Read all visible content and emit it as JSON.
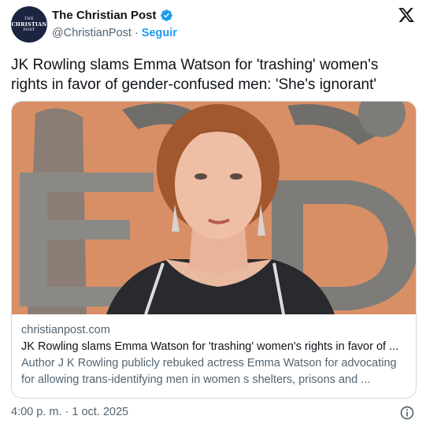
{
  "header": {
    "avatar_lines": [
      "THE",
      "CHRISTIAN",
      "POST"
    ],
    "display_name": "The Christian Post",
    "handle": "@ChristianPost",
    "separator": "·",
    "follow_label": "Seguir",
    "verified_icon": "verified-badge-icon",
    "platform_icon": "x-logo-icon"
  },
  "tweet": {
    "text": "JK Rowling slams Emma Watson for 'trashing' women's rights in favor of gender-confused men: 'She's ignorant'"
  },
  "link_card": {
    "image_icon": "news-photo",
    "domain": "christianpost.com",
    "title": "JK Rowling slams Emma Watson for 'trashing' women's rights in favor of ...",
    "description": "Author J K Rowling publicly rebuked actress Emma Watson for advocating for allowing trans-identifying men in women s shelters, prisons and ..."
  },
  "footer": {
    "timestamp": "4:00 p. m. · 1 oct. 2025",
    "info_icon": "info-icon"
  },
  "colors": {
    "accent": "#1d9bf0",
    "text": "#0f1419",
    "muted": "#536471",
    "border": "#cfd9de",
    "avatar_bg": "#1b2440",
    "photo_bg": "#d98f66"
  }
}
